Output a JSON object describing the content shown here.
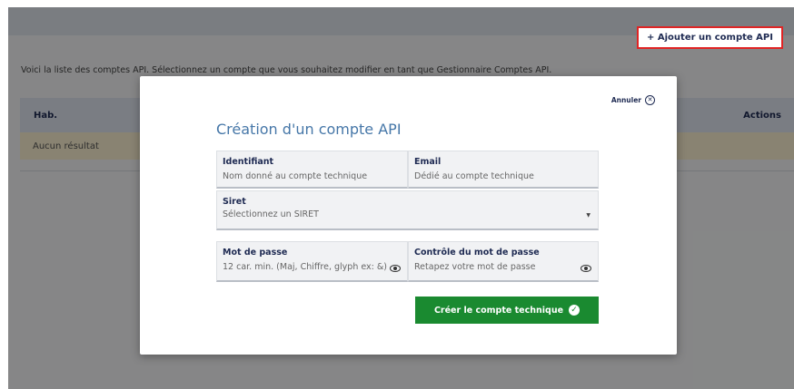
{
  "header": {
    "add_button_label": "+ Ajouter un compte API"
  },
  "intro_text": "Voici la liste des comptes API. Sélectionnez un compte que vous souhaitez modifier en tant que Gestionnaire Comptes API.",
  "table": {
    "columns": [
      "Hab.",
      "Actions"
    ],
    "empty_text": "Aucun résultat"
  },
  "modal": {
    "cancel_label": "Annuler",
    "cancel_icon": "close-circle-icon",
    "title": "Création d'un compte API",
    "fields": {
      "identifiant": {
        "label": "Identifiant",
        "placeholder": "Nom donné au compte technique"
      },
      "email": {
        "label": "Email",
        "placeholder": "Dédié au compte technique"
      },
      "siret": {
        "label": "Siret",
        "value": "Sélectionnez un SIRET"
      },
      "password": {
        "label": "Mot de passe",
        "placeholder": "12 car. min. (Maj, Chiffre, glyph ex: &)",
        "icon": "eye-icon"
      },
      "password_confirm": {
        "label": "Contrôle du mot de passe",
        "placeholder": "Retapez votre mot de passe",
        "icon": "eye-icon"
      }
    },
    "submit_label": "Créer le compte technique",
    "submit_icon": "check-circle-icon"
  },
  "colors": {
    "accent_title": "#4677a8",
    "navy_text": "#1e2a52",
    "submit_green": "#1a8a30",
    "highlight_red": "#e02424",
    "empty_row_bg": "#f9efcf"
  }
}
